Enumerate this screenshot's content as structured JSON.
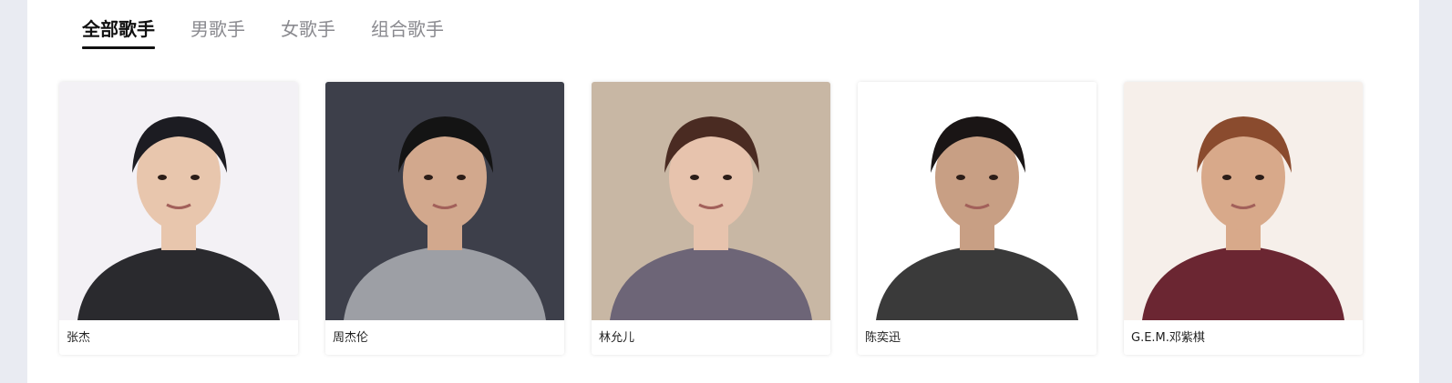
{
  "tabs": [
    {
      "label": "全部歌手",
      "active": true
    },
    {
      "label": "男歌手",
      "active": false
    },
    {
      "label": "女歌手",
      "active": false
    },
    {
      "label": "组合歌手",
      "active": false
    }
  ],
  "singers": [
    {
      "name": "张杰",
      "bg": "#f3f1f5",
      "hair": "#1c1c22",
      "skin": "#e8c6ad",
      "shirt": "#2a2a2e"
    },
    {
      "name": "周杰伦",
      "bg": "#3d3f4a",
      "hair": "#141414",
      "skin": "#d2a88d",
      "shirt": "#9d9fa5"
    },
    {
      "name": "林允儿",
      "bg": "#c8b7a4",
      "hair": "#4a2b22",
      "skin": "#e7c3ad",
      "shirt": "#6d6577"
    },
    {
      "name": "陈奕迅",
      "bg": "#ffffff",
      "hair": "#1a1515",
      "skin": "#c89f84",
      "shirt": "#3a3a3a"
    },
    {
      "name": "G.E.M.邓紫棋",
      "bg": "#f6efea",
      "hair": "#8a4b2e",
      "skin": "#d8a98a",
      "shirt": "#6b2632"
    }
  ]
}
